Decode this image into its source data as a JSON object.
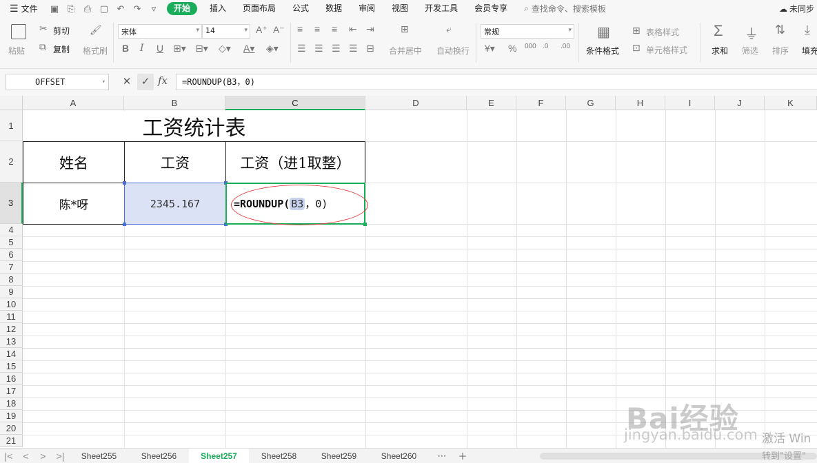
{
  "menubar": {
    "file_label": "文件",
    "tabs": [
      "开始",
      "插入",
      "页面布局",
      "公式",
      "数据",
      "审阅",
      "视图",
      "开发工具",
      "会员专享"
    ],
    "search_placeholder": "查找命令、搜索模板",
    "sync_label": "未同步"
  },
  "ribbon": {
    "paste": "粘贴",
    "cut": "剪切",
    "copy": "复制",
    "format_painter": "格式刷",
    "font_name": "宋体",
    "font_size": "14",
    "merge_center": "合并居中",
    "wrap_text": "自动换行",
    "number_format": "常规",
    "cond_format": "条件格式",
    "table_style": "表格样式",
    "cell_style": "单元格样式",
    "sum": "求和",
    "filter": "筛选",
    "sort": "排序",
    "fill": "填充"
  },
  "formula_bar": {
    "name_box": "OFFSET",
    "fx_label": "fx",
    "formula": "=ROUNDUP(B3，0)"
  },
  "grid": {
    "columns": [
      "A",
      "B",
      "C",
      "D",
      "E",
      "F",
      "G",
      "H",
      "I",
      "J",
      "K"
    ],
    "rows": [
      "1",
      "2",
      "3",
      "4",
      "5",
      "6",
      "7",
      "8",
      "9",
      "10",
      "11",
      "12",
      "13",
      "14",
      "15",
      "16",
      "17",
      "18",
      "19",
      "20",
      "21"
    ],
    "selected_column": "C",
    "selected_row": "3"
  },
  "sheet": {
    "title": "工资统计表",
    "headers": [
      "姓名",
      "工资",
      "工资（进1取整）"
    ],
    "row": {
      "name": "陈*呀",
      "salary": "2345.167",
      "formula_prefix": "=ROUNDUP(",
      "formula_ref": "B3",
      "formula_suffix": "，0)"
    }
  },
  "sheet_tabs": [
    "Sheet255",
    "Sheet256",
    "Sheet257",
    "Sheet258",
    "Sheet259",
    "Sheet260"
  ],
  "active_sheet": "Sheet257",
  "watermark": {
    "brand": "Bai经验",
    "url": "jingyan.baidu.com",
    "activate_line1": "激活 Win",
    "activate_line2": "转到\"设置\""
  },
  "colors": {
    "accent_green": "#1aad5c",
    "selection_blue": "#4d6ed6",
    "highlight_red": "#e23b3b"
  }
}
